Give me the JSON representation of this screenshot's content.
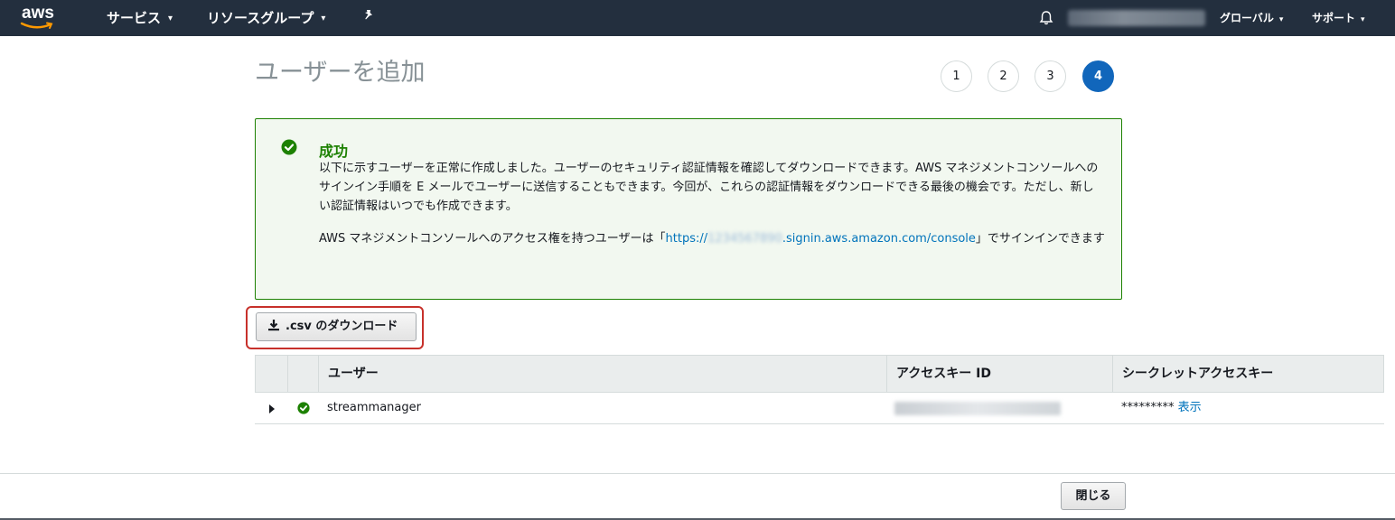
{
  "nav": {
    "logo": "aws",
    "services": "サービス",
    "resource_groups": "リソースグループ",
    "pin_icon": "pin-icon",
    "bell_icon": "bell-icon",
    "region": "グローバル",
    "support": "サポート",
    "caret": "▾"
  },
  "page": {
    "title": "ユーザーを追加",
    "steps": [
      "1",
      "2",
      "3",
      "4"
    ],
    "active_step": "4"
  },
  "success": {
    "title": "成功",
    "body": "以下に示すユーザーを正常に作成しました。ユーザーのセキュリティ認証情報を確認してダウンロードできます。AWS マネジメントコンソールへのサインイン手順を E メールでユーザーに送信することもできます。今回が、これらの認証情報をダウンロードできる最後の機会です。ただし、新しい認証情報はいつでも作成できます。",
    "console_prefix": "AWS マネジメントコンソールへのアクセス権を持つユーザーは「",
    "link_start": "https://",
    "link_end": ".signin.aws.amazon.com/console",
    "console_suffix": "」でサインインできます"
  },
  "download": {
    "label": ".csv のダウンロード"
  },
  "table": {
    "headers": [
      "ユーザー",
      "アクセスキー ID",
      "シークレットアクセスキー"
    ],
    "rows": [
      {
        "user": "streammanager",
        "secret_mask": "*********",
        "show_label": "表示"
      }
    ]
  },
  "footer": {
    "close_label": "閉じる"
  },
  "colors": {
    "nav_bg": "#232f3e",
    "success_green": "#1d8102",
    "link_blue": "#0073bb",
    "active_step": "#1166bb",
    "highlight_red": "#c7312b"
  }
}
